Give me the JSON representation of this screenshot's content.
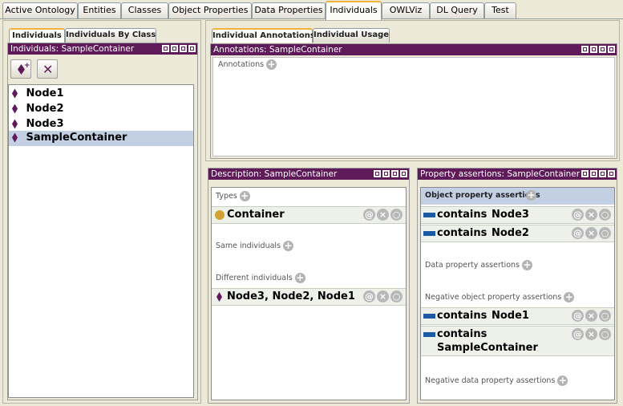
{
  "main_tabs": [
    {
      "label": "Active Ontology"
    },
    {
      "label": "Entities"
    },
    {
      "label": "Classes"
    },
    {
      "label": "Object Properties"
    },
    {
      "label": "Data Properties"
    },
    {
      "label": "Individuals"
    },
    {
      "label": "OWLViz"
    },
    {
      "label": "DL Query"
    },
    {
      "label": "Test"
    }
  ],
  "active_tab": "Individuals",
  "left_subtabs": [
    {
      "label": "Individuals"
    },
    {
      "label": "Individuals By Class"
    }
  ],
  "individuals_view": {
    "title": "Individuals: SampleContainer",
    "items": [
      {
        "label": "Node1"
      },
      {
        "label": "Node2"
      },
      {
        "label": "Node3"
      },
      {
        "label": "SampleContainer"
      }
    ],
    "selected": "SampleContainer"
  },
  "right_subtabs": [
    {
      "label": "Individual Annotations"
    },
    {
      "label": "Individual Usage"
    }
  ],
  "annotations_view": {
    "title": "Annotations: SampleContainer",
    "annotations_label": "Annotations"
  },
  "description_view": {
    "title": "Description: SampleContainer",
    "types_label": "Types",
    "types": [
      {
        "label": "Container"
      }
    ],
    "same_label": "Same individuals",
    "different_label": "Different individuals",
    "different": [
      {
        "label": "Node3, Node2, Node1"
      }
    ]
  },
  "property_view": {
    "title": "Property assertions: SampleContainer",
    "object_label": "Object property assertions",
    "object_assertions": [
      {
        "property": "contains",
        "value": "Node3"
      },
      {
        "property": "contains",
        "value": "Node2"
      }
    ],
    "data_label": "Data property assertions",
    "neg_object_label": "Negative object property assertions",
    "neg_object_assertions": [
      {
        "property": "contains",
        "value": "Node1"
      },
      {
        "property": "contains",
        "value": "SampleContainer"
      }
    ],
    "neg_data_label": "Negative data property assertions"
  },
  "icons": {
    "add": "+",
    "annotate": "@",
    "delete": "×",
    "edit": "○"
  },
  "colors": {
    "header": "#5e1a59",
    "selection": "#c3d0e4",
    "class": "#d4a033",
    "property": "#1c5aa6"
  }
}
